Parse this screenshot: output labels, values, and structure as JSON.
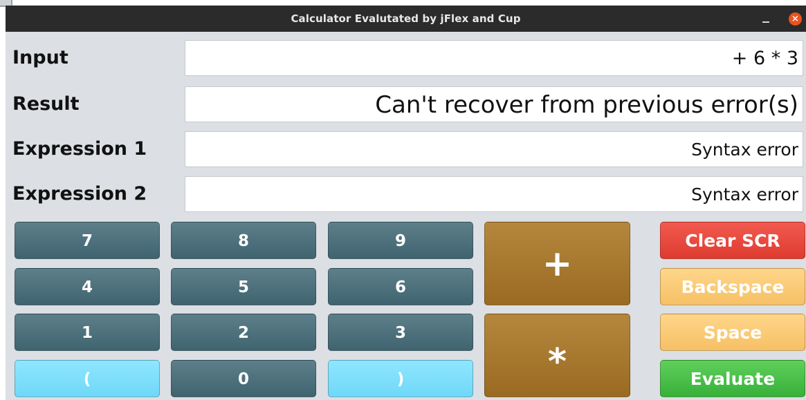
{
  "window": {
    "title": "Calculator Evalutated by jFlex and Cup",
    "minimize_icon": "minimize-icon",
    "close_icon": "close-icon",
    "close_glyph": "×"
  },
  "fields": {
    "input": {
      "label": "Input",
      "value": "+ 6 * 3"
    },
    "result": {
      "label": "Result",
      "value": "Can't recover from previous error(s)"
    },
    "expression1": {
      "label": "Expression 1",
      "value": "Syntax error"
    },
    "expression2": {
      "label": "Expression 2",
      "value": "Syntax error"
    }
  },
  "keypad": {
    "k7": "7",
    "k8": "8",
    "k9": "9",
    "k4": "4",
    "k5": "5",
    "k6": "6",
    "k1": "1",
    "k2": "2",
    "k3": "3",
    "open_paren": "(",
    "k0": "0",
    "close_paren": ")",
    "plus": "+",
    "times": "*"
  },
  "actions": {
    "clear": "Clear SCR",
    "backspace": "Backspace",
    "space": "Space",
    "evaluate": "Evaluate"
  },
  "colors": {
    "titlebar": "#2b2b2b",
    "window_bg": "#dcdfe3",
    "digit_button": "#4a6f7b",
    "paren_button": "#7fdffc",
    "operator_button": "#a87a2e",
    "clear_button": "#e8453a",
    "soft_button": "#fbc876",
    "evaluate_button": "#45bf47",
    "close_button": "#e95420"
  }
}
